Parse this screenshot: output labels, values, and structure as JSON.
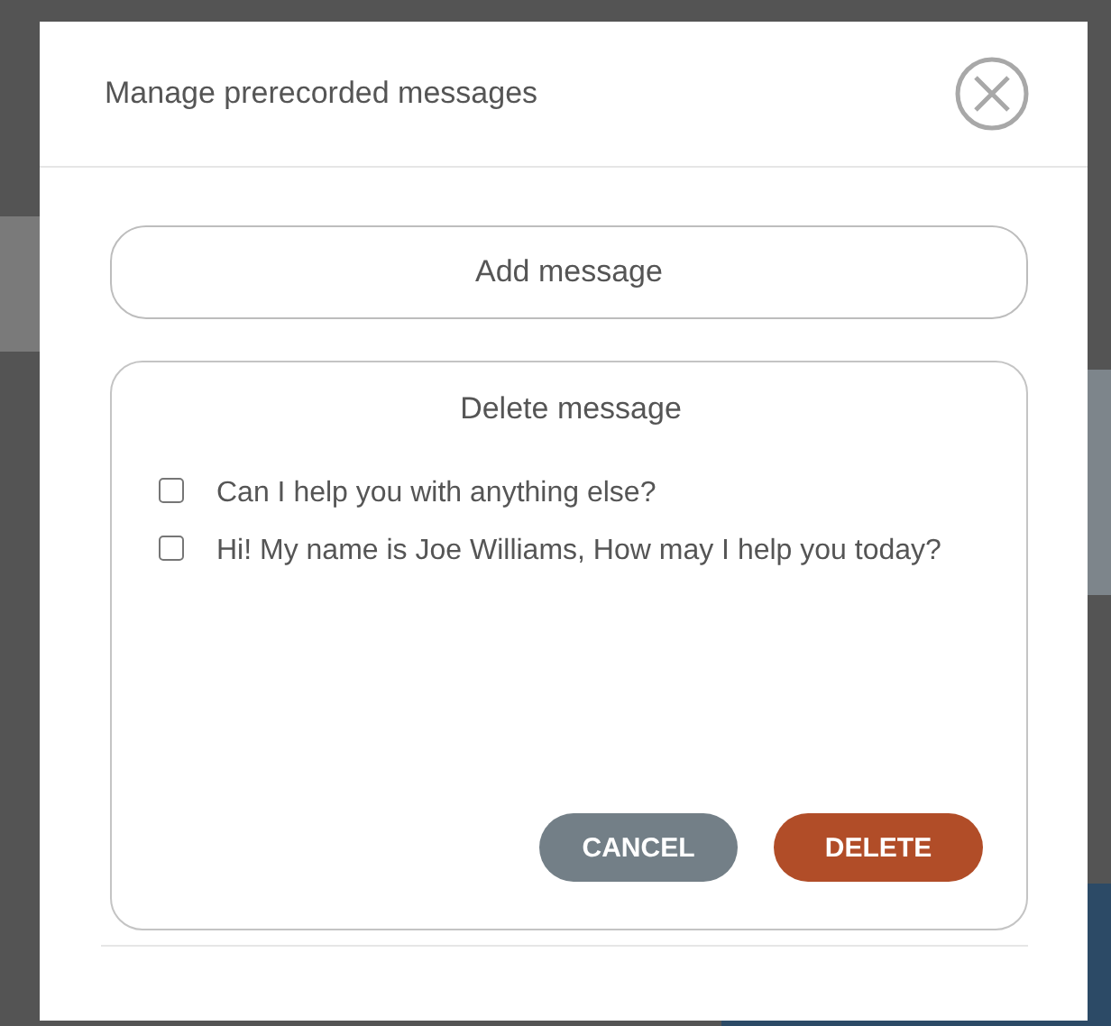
{
  "dialog": {
    "title": "Manage prerecorded messages"
  },
  "add_button": {
    "label": "Add message"
  },
  "delete_panel": {
    "title": "Delete message",
    "messages": [
      {
        "text": "Can I help you with anything else?",
        "checked": false
      },
      {
        "text": "Hi! My name is Joe Williams, How may I help you today?",
        "checked": false
      }
    ],
    "buttons": [
      {
        "label": "CANCEL",
        "kind": "secondary"
      },
      {
        "label": "DELETE",
        "kind": "danger"
      }
    ]
  }
}
